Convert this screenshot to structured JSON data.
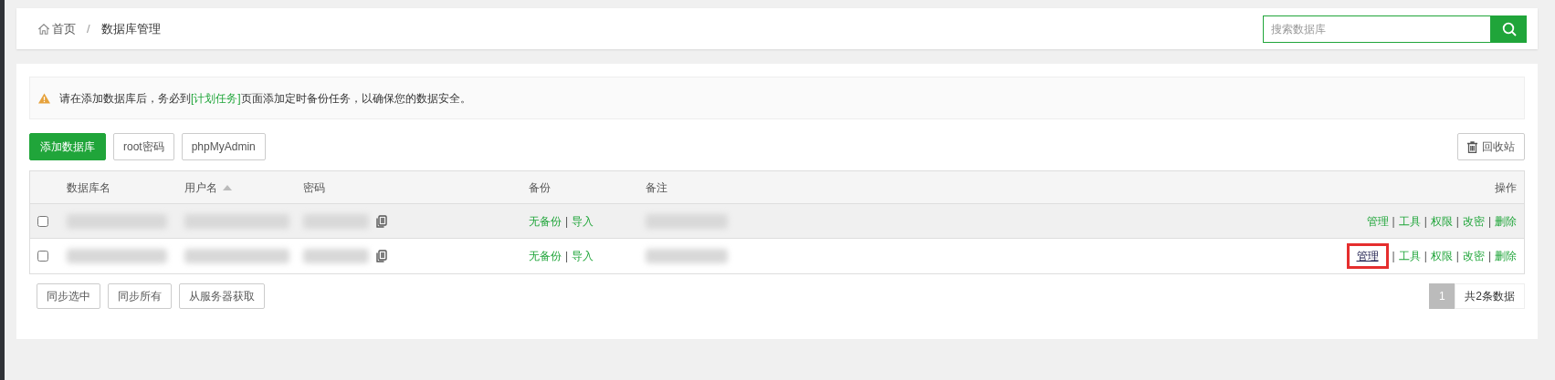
{
  "breadcrumb": [
    {
      "label": "首页",
      "kind": "home"
    },
    {
      "label": "数据库管理",
      "kind": "page"
    }
  ],
  "breadcrumb_separator": "/",
  "link_separator": "|",
  "search": {
    "placeholder": "搜索数据库"
  },
  "notice": {
    "before": "请在添加数据库后，务必到",
    "link": "[计划任务]",
    "after": "页面添加定时备份任务，以确保您的数据安全。"
  },
  "toolbar": [
    {
      "label": "添加数据库",
      "kind": "primary"
    },
    {
      "label": "root密码",
      "kind": "default"
    },
    {
      "label": "phpMyAdmin",
      "kind": "default"
    }
  ],
  "recycle_button": "回收站",
  "table": {
    "columns": [
      {
        "label": "数据库名",
        "sorted": false
      },
      {
        "label": "用户名",
        "sorted": true
      },
      {
        "label": "密码",
        "sorted": false
      },
      {
        "label": "备份",
        "sorted": false
      },
      {
        "label": "备注",
        "sorted": false
      },
      {
        "label": "操作",
        "sorted": false
      }
    ],
    "rows": [
      {
        "checked": false,
        "hovered": true,
        "backup": [
          "无备份",
          "导入"
        ],
        "actions": [
          {
            "label": "管理",
            "highlighted": false
          },
          {
            "label": "工具",
            "highlighted": false
          },
          {
            "label": "权限",
            "highlighted": false
          },
          {
            "label": "改密",
            "highlighted": false
          },
          {
            "label": "删除",
            "highlighted": false
          }
        ]
      },
      {
        "checked": false,
        "hovered": false,
        "backup": [
          "无备份",
          "导入"
        ],
        "actions": [
          {
            "label": "管理",
            "highlighted": true
          },
          {
            "label": "工具",
            "highlighted": false
          },
          {
            "label": "权限",
            "highlighted": false
          },
          {
            "label": "改密",
            "highlighted": false
          },
          {
            "label": "删除",
            "highlighted": false
          }
        ]
      }
    ]
  },
  "footer_buttons": [
    "同步选中",
    "同步所有",
    "从服务器获取"
  ],
  "pagination": {
    "pages": [
      {
        "label": "1",
        "selected": true
      }
    ],
    "summary": "共2条数据"
  }
}
